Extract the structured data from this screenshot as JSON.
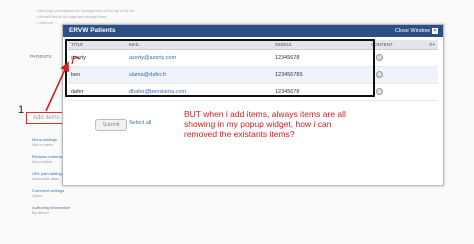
{
  "background": {
    "note_lines": [
      "• Web page permissions are managed here at the top of the list...",
      "• Allowed files on the page are managed here...",
      "• Links text ...."
    ],
    "patients_label": "PATIENTS",
    "sidebar_items": [
      {
        "title": "Menu settings",
        "sub": "Not in menu"
      },
      {
        "title": "Revision information",
        "sub": "No revision"
      },
      {
        "title": "URL path settings",
        "sub": "Automatic alias"
      },
      {
        "title": "Comment settings",
        "sub": "Open"
      },
      {
        "title": "Authoring information",
        "sub": "By admin"
      }
    ]
  },
  "annotation_number": "1",
  "add_items_label": "Add items",
  "modal": {
    "title": "ERVW Patients",
    "close_label": "Close Window",
    "columns": [
      "TITLE",
      "MAIL",
      "MOBILE",
      "CONTENT"
    ],
    "rows": [
      {
        "title": "azerty",
        "mail": "azerty@azerty.com",
        "mobile": "12345678"
      },
      {
        "title": "ben",
        "mail": "slama@dafer.fr",
        "mobile": "123456789"
      },
      {
        "title": "dafer",
        "mail": "dhafer@benslama.com",
        "mobile": "12345678"
      }
    ],
    "submit_label": "Submit",
    "select_all_label": "Select all"
  },
  "annotation_text": "BUT when i add items, always items are all\nshowing in my popup widget, how i can\nremoved the existants items?",
  "colors": {
    "accent": "#2b4f86",
    "annotation": "#d01e24",
    "highlight_box": "#111111"
  }
}
